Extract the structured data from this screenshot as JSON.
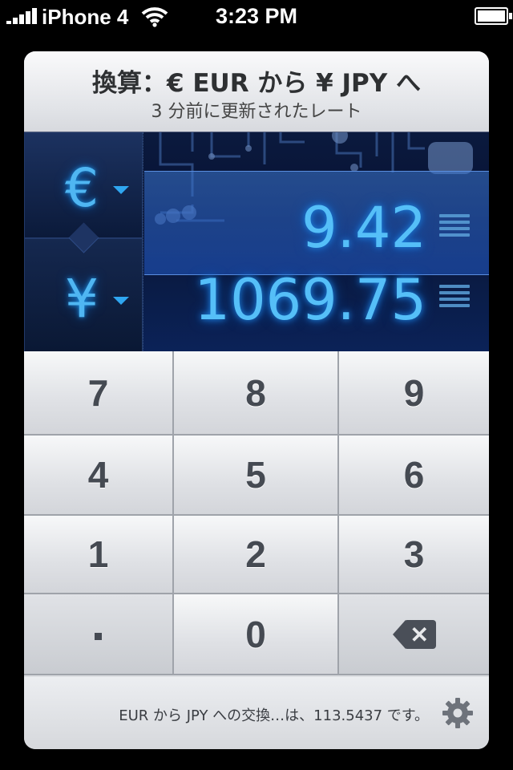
{
  "status_bar": {
    "carrier": "iPhone 4",
    "time": "3:23 PM",
    "signal_bars": 5,
    "battery_level": 1.0
  },
  "header": {
    "title": "換算：€ EUR から ¥ JPY へ",
    "subtitle": "3 分前に更新されたレート"
  },
  "converter": {
    "from_symbol": "€",
    "to_symbol": "¥",
    "from_amount": "9.42",
    "to_amount": "1069.75"
  },
  "keypad": {
    "keys": [
      "7",
      "8",
      "9",
      "4",
      "5",
      "6",
      "1",
      "2",
      "3"
    ],
    "zero": "0",
    "backspace_icon": "backspace-icon",
    "decimal_icon": "decimal-point"
  },
  "footer": {
    "message": "EUR から JPY への交換…は、113.5437 です。",
    "settings_icon": "gear-icon"
  },
  "colors": {
    "display_glow": "#55bff8",
    "accent_caret": "#2fa6f0"
  }
}
